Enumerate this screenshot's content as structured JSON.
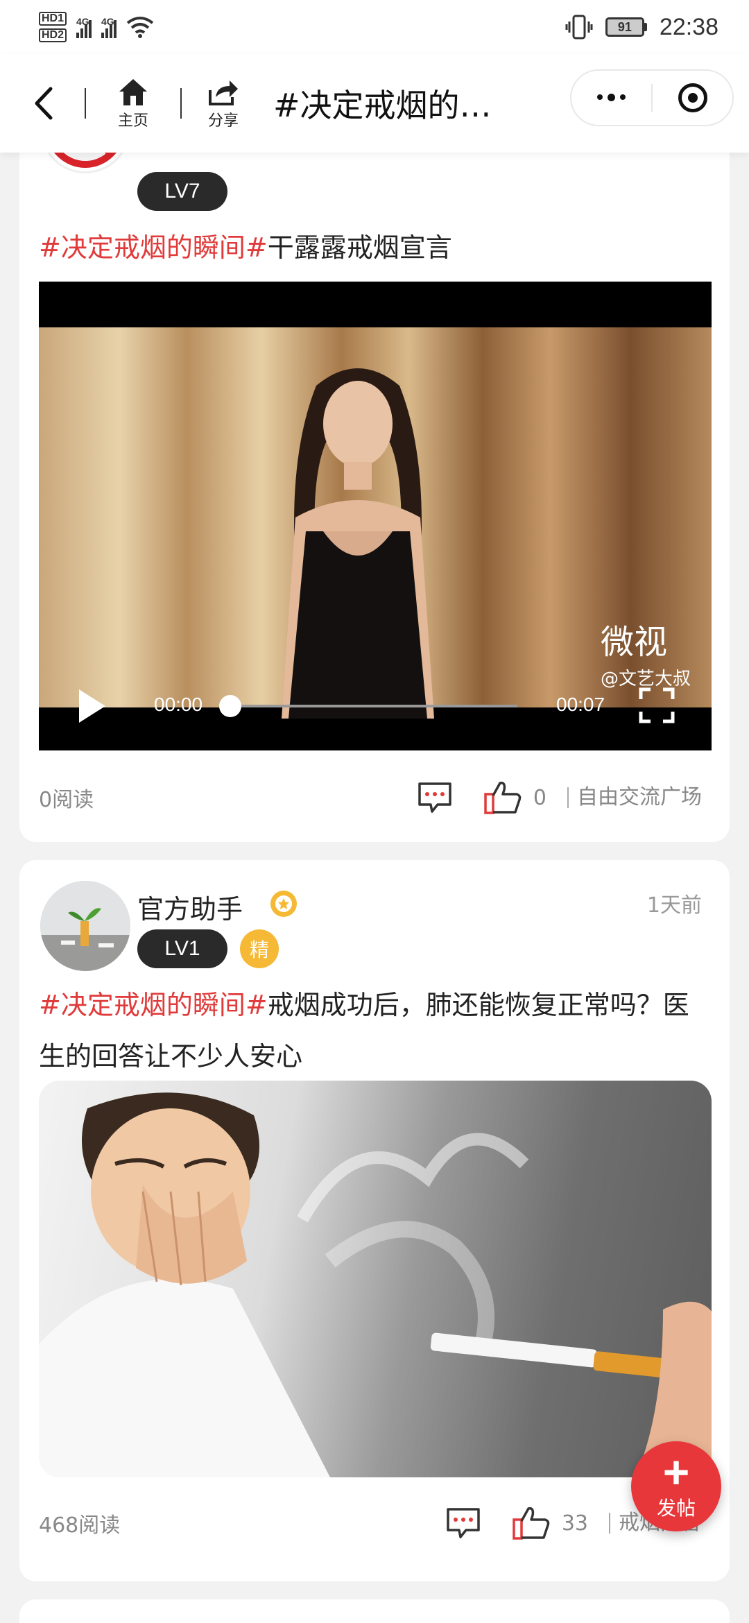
{
  "status_bar": {
    "hd1": "HD1",
    "hd2": "HD2",
    "net1": "4G",
    "net2": "4G",
    "battery": "91",
    "time": "22:38"
  },
  "navbar": {
    "home_label": "主页",
    "share_label": "分享",
    "title": "#决定戒烟的…"
  },
  "posts": [
    {
      "level": "LV7",
      "hashtag": "#决定戒烟的瞬间#",
      "title_rest": "干露露戒烟宣言",
      "video": {
        "current_time": "00:00",
        "duration": "00:07",
        "watermark": "微视",
        "watermark_author": "@文艺大叔",
        "progress": 0
      },
      "reads": "0阅读",
      "likes": "0",
      "board": "自由交流广场"
    },
    {
      "author": "官方助手",
      "level": "LV1",
      "badge": "精",
      "time_ago": "1天前",
      "hashtag": "#决定戒烟的瞬间#",
      "title_rest": "戒烟成功后，肺还能恢复正常吗？医生的回答让不少人安心",
      "reads": "468阅读",
      "likes": "33",
      "board": "戒烟问答"
    }
  ],
  "fab": {
    "label": "发帖"
  },
  "colors": {
    "accent": "#e03a3a",
    "fab": "#e8373a",
    "badge": "#f5b935"
  }
}
